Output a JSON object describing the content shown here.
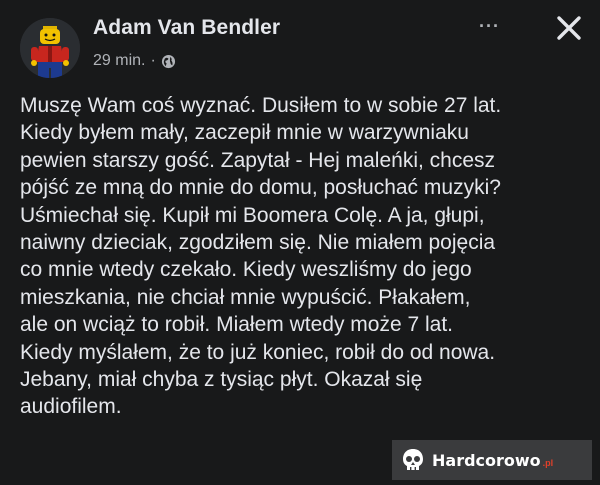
{
  "post": {
    "author": "Adam Van Bendler",
    "time": "29 min.",
    "separator": "·",
    "privacy_icon": "globe-icon",
    "more_label": "···",
    "close_icon": "close-icon",
    "text": "Muszę Wam coś wyznać. Dusiłem to w sobie 27 lat.\nKiedy byłem mały, zaczepił mnie w warzywniaku\npewien starszy gość. Zapytał - Hej maleńki, chcesz\npójść ze mną do mnie do domu, posłuchać muzyki?\nUśmiechał się. Kupił mi Boomera Colę. A ja, głupi,\nnaiwny dzieciak, zgodziłem się. Nie miałem pojęcia\nco mnie wtedy czekało. Kiedy weszliśmy do jego\nmieszkania, nie chciał mnie wypuścić. Płakałem,\nale on wciąż to robił. Miałem wtedy może 7 lat.\nKiedy myślałem, że to już koniec, robił do od nowa.\nJebany, miał chyba z tysiąc płyt. Okazał się\naudiofilem."
  },
  "watermark": {
    "text": "Hardcorowo",
    "suffix": ".pl",
    "icon": "skull-logo-icon"
  },
  "colors": {
    "background": "#18191a",
    "text_primary": "#e4e6eb",
    "text_secondary": "#b0b3b8"
  }
}
